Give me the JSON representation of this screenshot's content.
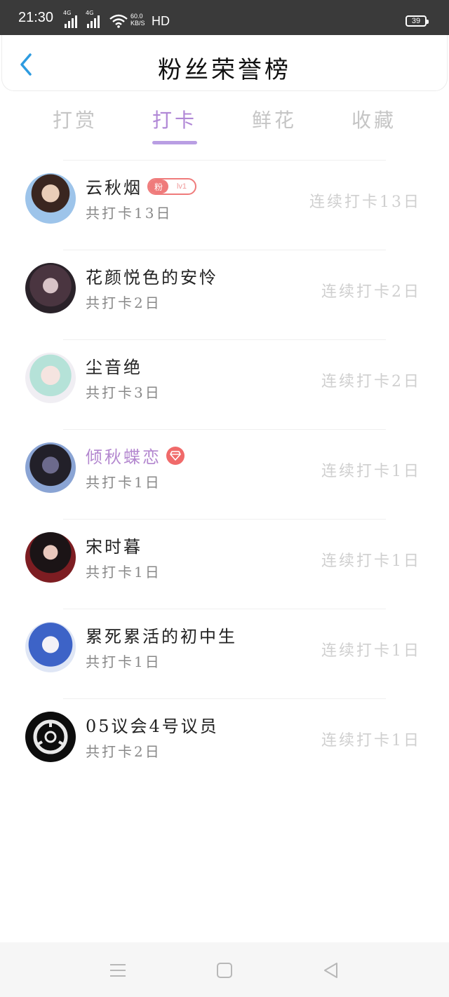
{
  "status_bar": {
    "time": "21:30",
    "sim1": "4G",
    "sim2": "4G",
    "speed_value": "60.0",
    "speed_unit": "KB/S",
    "hd": "HD",
    "battery": "39"
  },
  "header": {
    "title": "粉丝荣誉榜",
    "back_icon": "chevron-left-icon"
  },
  "tabs": [
    {
      "label": "打赏",
      "active": false
    },
    {
      "label": "打卡",
      "active": true
    },
    {
      "label": "鲜花",
      "active": false
    },
    {
      "label": "收藏",
      "active": false
    }
  ],
  "colors": {
    "accent": "#b087d6",
    "back_arrow": "#2d9be0",
    "badge_red": "#ef7b7b",
    "streak_text": "#cfcfcf"
  },
  "rows": [
    {
      "name": "云秋烟",
      "total": "共打卡13日",
      "streak": "连续打卡13日",
      "badge": {
        "type": "fan",
        "label": "粉",
        "level": "lv1"
      }
    },
    {
      "name": "花颜悦色的安怜",
      "total": "共打卡2日",
      "streak": "连续打卡2日"
    },
    {
      "name": "尘音绝",
      "total": "共打卡3日",
      "streak": "连续打卡2日"
    },
    {
      "name": "倾秋蝶恋",
      "total": "共打卡1日",
      "streak": "连续打卡1日",
      "vip": true,
      "badge": {
        "type": "gem",
        "icon": "diamond-icon"
      }
    },
    {
      "name": "宋时暮",
      "total": "共打卡1日",
      "streak": "连续打卡1日"
    },
    {
      "name": "累死累活的初中生",
      "total": "共打卡1日",
      "streak": "连续打卡1日"
    },
    {
      "name": "05议会4号议员",
      "total": "共打卡2日",
      "streak": "连续打卡1日"
    }
  ],
  "nav": {
    "items": [
      "menu-icon",
      "home-square-icon",
      "back-triangle-icon"
    ]
  }
}
